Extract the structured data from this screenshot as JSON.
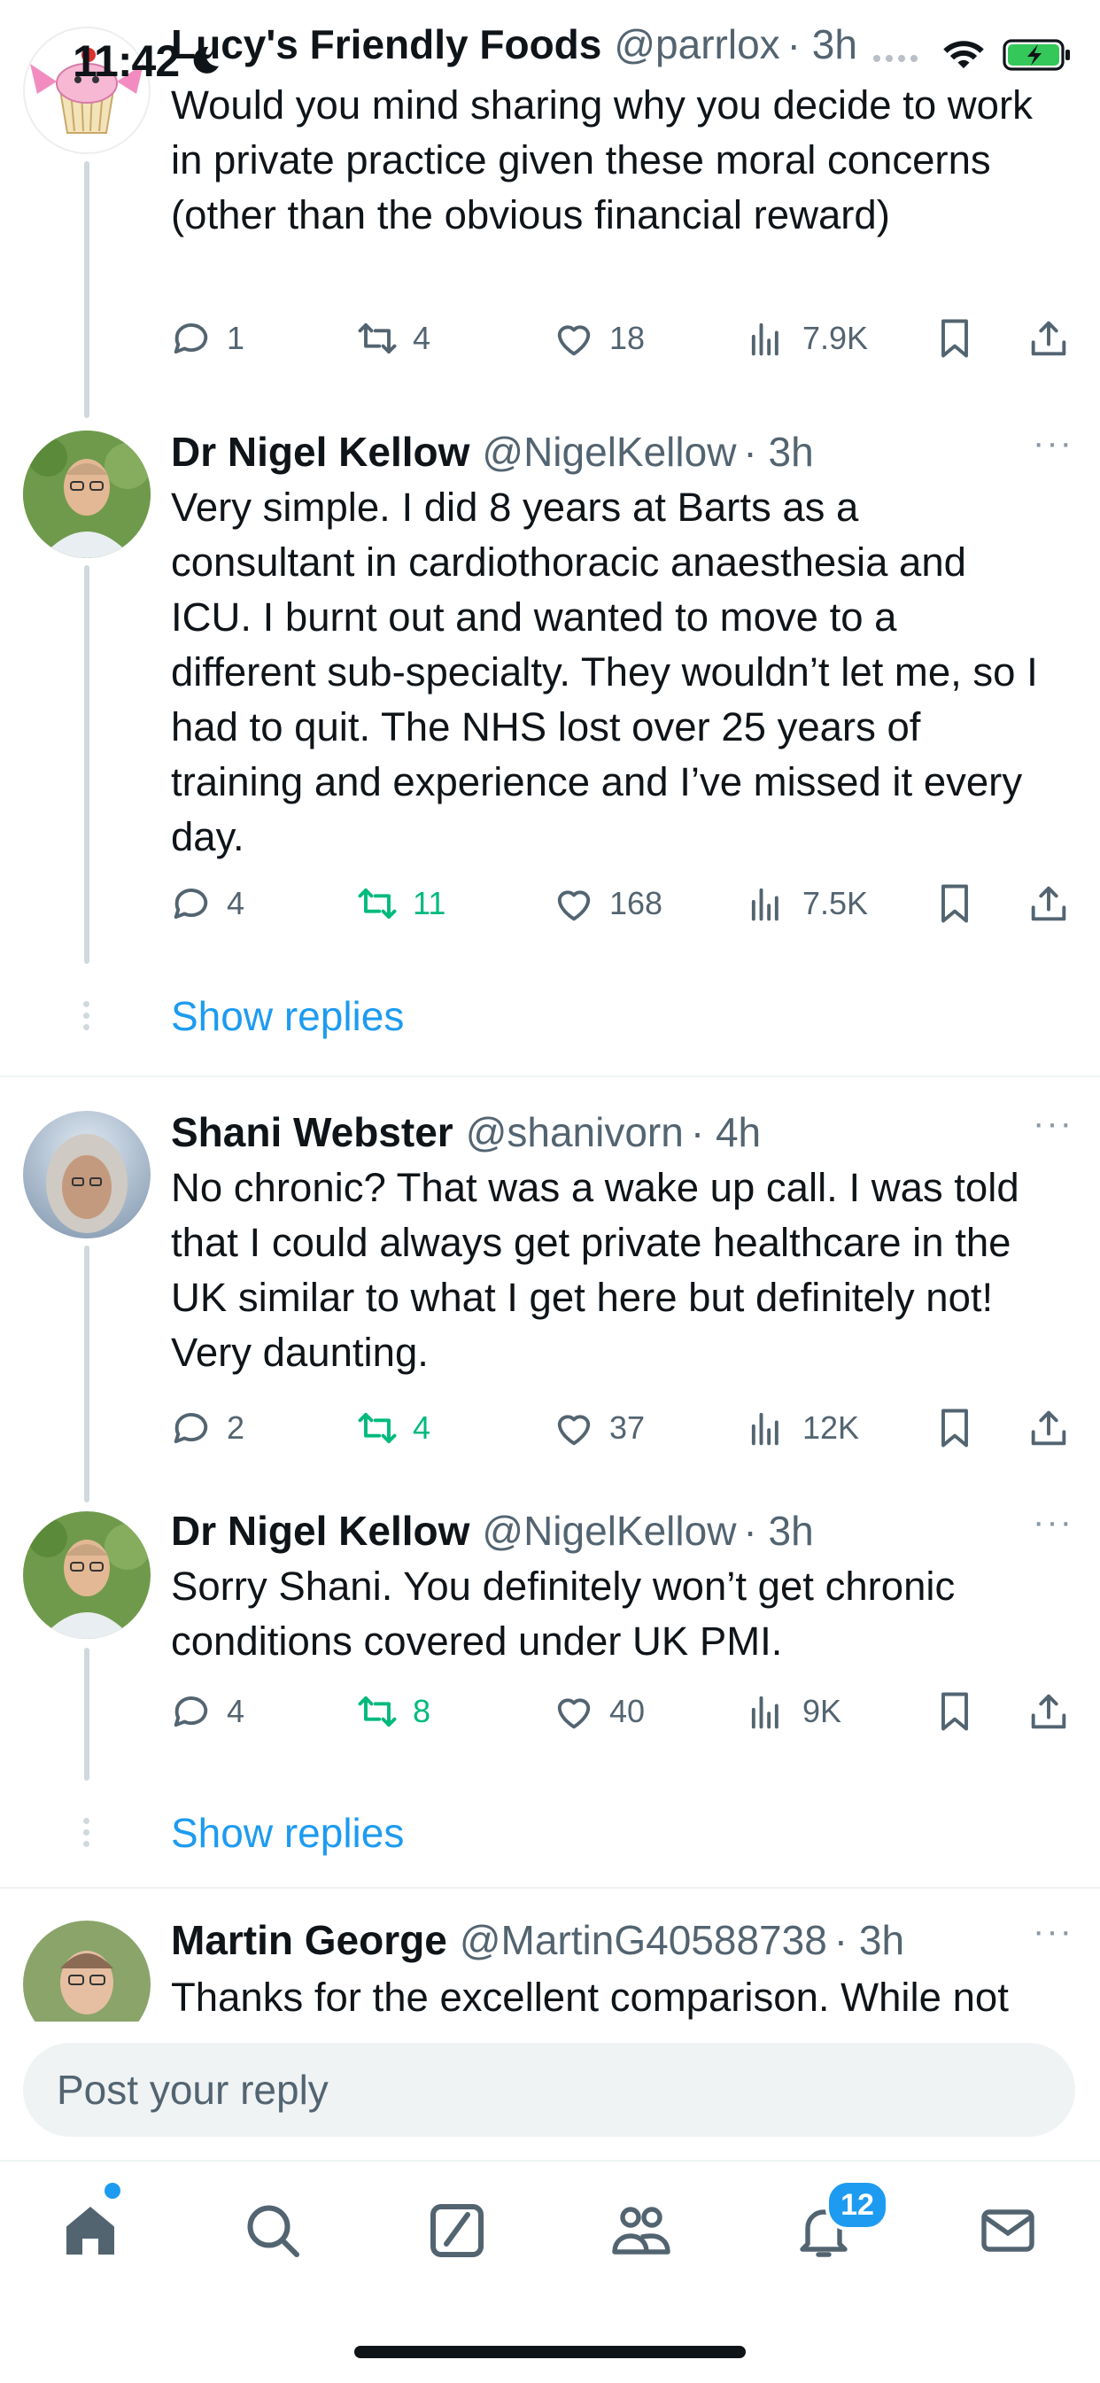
{
  "status_bar": {
    "time": "11:42"
  },
  "tweets": [
    {
      "name": "Lucy's Friendly Foods",
      "handle": "@parrlox",
      "time": "· 3h",
      "text": "Would you mind sharing why you decide to work in private practice given these moral concerns (other than the obvious financial reward)",
      "replies": "1",
      "retweets": "4",
      "likes": "18",
      "views": "7.9K",
      "retweet_color": "#536471"
    },
    {
      "name": "Dr Nigel Kellow",
      "handle": "@NigelKellow",
      "time": "· 3h",
      "text": "Very simple. I did 8 years at Barts as a consultant in cardiothoracic anaesthesia and ICU. I burnt out and wanted to move to a different sub-specialty. They wouldn’t let me, so I had to quit. The NHS lost over 25 years of training and experience and I’ve missed it every day.",
      "replies": "4",
      "retweets": "11",
      "likes": "168",
      "views": "7.5K",
      "retweet_color": "#00ba7c"
    },
    {
      "name": "Shani Webster",
      "handle": "@shanivorn",
      "time": "· 4h",
      "text": "No chronic? That was a wake up call. I was told that I could always get private healthcare in the UK similar to what I get here but definitely not! Very daunting.",
      "replies": "2",
      "retweets": "4",
      "likes": "37",
      "views": "12K",
      "retweet_color": "#00ba7c"
    },
    {
      "name": "Dr Nigel Kellow",
      "handle": "@NigelKellow",
      "time": "· 3h",
      "text": "Sorry Shani. You definitely won’t get chronic conditions covered under UK PMI.",
      "replies": "4",
      "retweets": "8",
      "likes": "40",
      "views": "9K",
      "retweet_color": "#00ba7c"
    },
    {
      "name": "Martin George",
      "handle": "@MartinG40588738",
      "time": "· 3h",
      "text": "Thanks for the excellent comparison. While not"
    }
  ],
  "show_replies_label": "Show replies",
  "reply_bar": {
    "placeholder": "Post your reply"
  },
  "tabbar": {
    "items": [
      "home-icon",
      "search-icon",
      "grok-icon",
      "communities-icon",
      "notifications-icon",
      "messages-icon"
    ],
    "notifications_badge": "12"
  },
  "colors": {
    "accent": "#1d9bf0",
    "retweet_active": "#00ba7c",
    "muted": "#536471"
  }
}
